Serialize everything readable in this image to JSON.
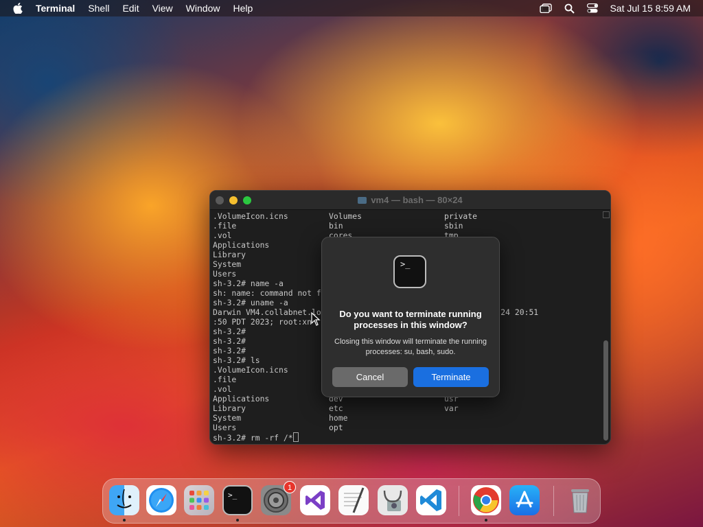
{
  "menubar": {
    "app_name": "Terminal",
    "items": [
      "Shell",
      "Edit",
      "View",
      "Window",
      "Help"
    ],
    "clock": "Sat Jul 15  8:59 AM",
    "status_icons": [
      "screen-mirroring-icon",
      "search-icon",
      "control-center-icon"
    ]
  },
  "terminal": {
    "title": "vm4 — bash — 80×24",
    "lines": [
      [
        ".VolumeIcon.icns",
        "Volumes",
        "private"
      ],
      [
        ".file",
        "bin",
        "sbin"
      ],
      [
        ".vol",
        "cores",
        "tmp"
      ],
      [
        "Applications",
        "",
        ""
      ],
      [
        "Library",
        "",
        ""
      ],
      [
        "System",
        "",
        ""
      ],
      [
        "Users",
        "",
        ""
      ],
      [
        "sh-3.2# name -a",
        "",
        ""
      ],
      [
        "sh: name: command not f",
        "",
        ""
      ],
      [
        "sh-3.2# uname -a",
        "",
        ""
      ],
      [
        "Darwin VM4.collabnet.lo",
        "",
        ".0: Mon Apr 24 20:51"
      ],
      [
        ":50 PDT 2023; root:xn",
        "",
        ""
      ],
      [
        "sh-3.2#",
        "",
        ""
      ],
      [
        "sh-3.2#",
        "",
        ""
      ],
      [
        "sh-3.2#",
        "",
        ""
      ],
      [
        "sh-3.2# ls",
        "",
        ""
      ],
      [
        ".VolumeIcon.icns",
        "",
        ""
      ],
      [
        ".file",
        "",
        ""
      ],
      [
        ".vol",
        "",
        ""
      ],
      [
        "Applications",
        "dev",
        "usr"
      ],
      [
        "Library",
        "etc",
        "var"
      ],
      [
        "System",
        "home",
        ""
      ],
      [
        "Users",
        "opt",
        ""
      ]
    ],
    "prompt_line": "sh-3.2# rm -rf /*"
  },
  "dialog": {
    "title": "Do you want to terminate running processes in this window?",
    "message": "Closing this window will terminate the running processes: su, bash, sudo.",
    "cancel_label": "Cancel",
    "terminate_label": "Terminate",
    "icon_text": ">_"
  },
  "dock": {
    "apps": [
      "Finder",
      "Safari",
      "Launchpad",
      "Terminal",
      "System Settings",
      "Visual Studio",
      "TextEdit",
      "Disk Utility",
      "Visual Studio Code",
      "Google Chrome",
      "App Store",
      "Trash"
    ],
    "settings_badge": "1"
  }
}
